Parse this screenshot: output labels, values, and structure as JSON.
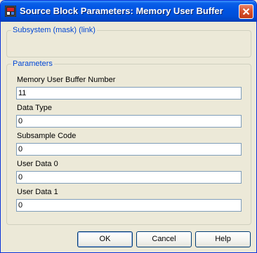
{
  "window": {
    "title": "Source Block Parameters: Memory User Buffer",
    "app_icon": "simulink-block-icon",
    "close_icon": "close-x-icon"
  },
  "mask_group": {
    "legend": "Subsystem (mask) (link)"
  },
  "parameters": {
    "legend": "Parameters",
    "fields": [
      {
        "label": "Memory User Buffer Number",
        "value": "11"
      },
      {
        "label": "Data Type",
        "value": "0"
      },
      {
        "label": "Subsample Code",
        "value": "0"
      },
      {
        "label": "User Data 0",
        "value": "0"
      },
      {
        "label": "User Data 1",
        "value": "0"
      }
    ]
  },
  "buttons": {
    "ok": "OK",
    "cancel": "Cancel",
    "help": "Help"
  }
}
